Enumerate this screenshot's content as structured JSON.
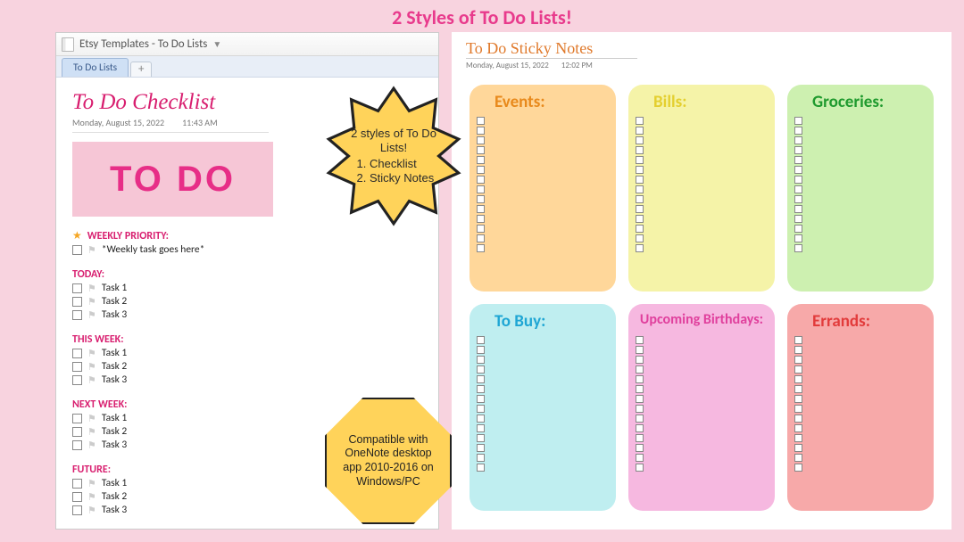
{
  "main_title": "2 Styles of To Do Lists!",
  "onenote": {
    "notebook_title": "Etsy Templates - To Do Lists",
    "tab_label": "To Do Lists",
    "page_title": "To Do Checklist",
    "date": "Monday, August 15, 2022",
    "time": "11:43 AM",
    "hero": "TO DO",
    "sections": {
      "priority": {
        "label": "WEEKLY PRIORITY:",
        "tasks": [
          "*Weekly task goes here*"
        ]
      },
      "today": {
        "label": "TODAY:",
        "tasks": [
          "Task 1",
          "Task 2",
          "Task 3"
        ]
      },
      "thisweek": {
        "label": "THIS WEEK:",
        "tasks": [
          "Task 1",
          "Task 2",
          "Task 3"
        ]
      },
      "nextweek": {
        "label": "NEXT WEEK:",
        "tasks": [
          "Task 1",
          "Task 2",
          "Task 3"
        ]
      },
      "future": {
        "label": "FUTURE:",
        "tasks": [
          "Task 1",
          "Task 2",
          "Task 3"
        ]
      }
    }
  },
  "sticky": {
    "title": "To Do Sticky Notes",
    "date": "Monday, August 15, 2022",
    "time": "12:02 PM",
    "notes": {
      "events": "Events:",
      "bills": "Bills:",
      "groc": "Groceries:",
      "tobuy": "To Buy:",
      "bday": "Upcoming Birthdays:",
      "errands": "Errands:"
    }
  },
  "callouts": {
    "star_line1": "2 styles of To Do Lists!",
    "star_item1": "Checklist",
    "star_item2": "Sticky Notes",
    "oct": "Compatible with OneNote desktop app 2010-2016 on Windows/PC"
  }
}
